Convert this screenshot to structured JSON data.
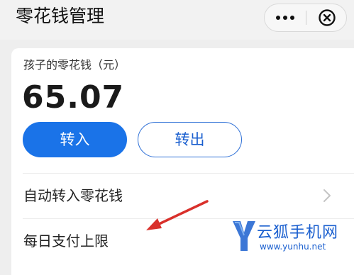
{
  "header": {
    "title": "零花钱管理",
    "more_icon": "more-dots-icon",
    "close_icon": "close-circle-icon"
  },
  "card": {
    "label": "孩子的零花钱（元）",
    "balance": "65.07",
    "transfer_in_label": "转入",
    "transfer_out_label": "转出"
  },
  "rows": [
    {
      "label": "自动转入零花钱",
      "icon": "chevron-right-icon"
    },
    {
      "label": "每日支付上限"
    }
  ],
  "watermark": {
    "logo_letter": "Y",
    "name": "云狐手机网",
    "url": "www.yunhu.net"
  },
  "colors": {
    "accent": "#1a73e8",
    "annotation_arrow": "#d9302b",
    "watermark": "#1a5fcf"
  }
}
